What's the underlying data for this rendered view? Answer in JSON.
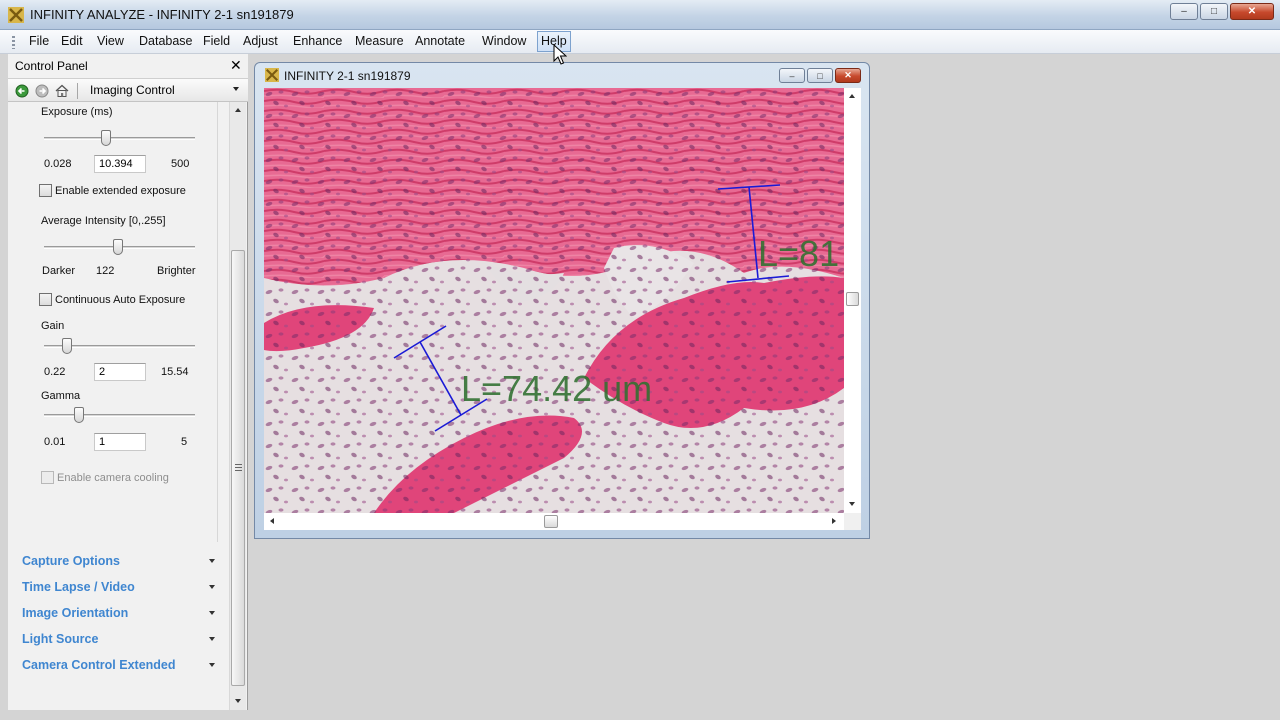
{
  "app": {
    "title": "INFINITY ANALYZE - INFINITY 2-1 sn191879",
    "icon": "app-logo-icon",
    "window_controls": {
      "minimize": "–",
      "maximize": "□",
      "close": "✕"
    }
  },
  "menubar": {
    "items": [
      "File",
      "Edit",
      "View",
      "Database",
      "Field",
      "Adjust",
      "Enhance",
      "Measure",
      "Annotate",
      "Window",
      "Help"
    ],
    "active": "Help"
  },
  "control_panel": {
    "title": "Control Panel",
    "close": "✕",
    "toolbar": {
      "icons": [
        "back-icon",
        "forward-icon",
        "home-icon"
      ],
      "section": "Imaging Control"
    },
    "exposure": {
      "label": "Exposure (ms)",
      "min": "0.028",
      "value": "10.394",
      "max": "500"
    },
    "extended_exposure": {
      "label": "Enable extended exposure",
      "checked": false
    },
    "avg_intensity": {
      "label": "Average Intensity [0,.255]",
      "left": "Darker",
      "value": "122",
      "right": "Brighter"
    },
    "auto_exposure": {
      "label": "Continuous Auto Exposure",
      "checked": false
    },
    "gain": {
      "label": "Gain",
      "min": "0.22",
      "value": "2",
      "max": "15.54"
    },
    "gamma": {
      "label": "Gamma",
      "min": "0.01",
      "value": "1",
      "max": "5"
    },
    "camera_cooling": {
      "label": "Enable camera cooling",
      "checked": false,
      "enabled": false
    },
    "sections": [
      "Capture Options",
      "Time Lapse / Video",
      "Image Orientation",
      "Light Source",
      "Camera Control Extended"
    ]
  },
  "image_window": {
    "title": "INFINITY 2-1 sn191879",
    "measurements": [
      "L=74.42 um",
      "L=81"
    ]
  },
  "colors": {
    "section_header": "#3f86d0",
    "measure_line": "#1a1ad6",
    "measure_text": "#2f6f2f",
    "tissue_pink": "#e0457a"
  }
}
